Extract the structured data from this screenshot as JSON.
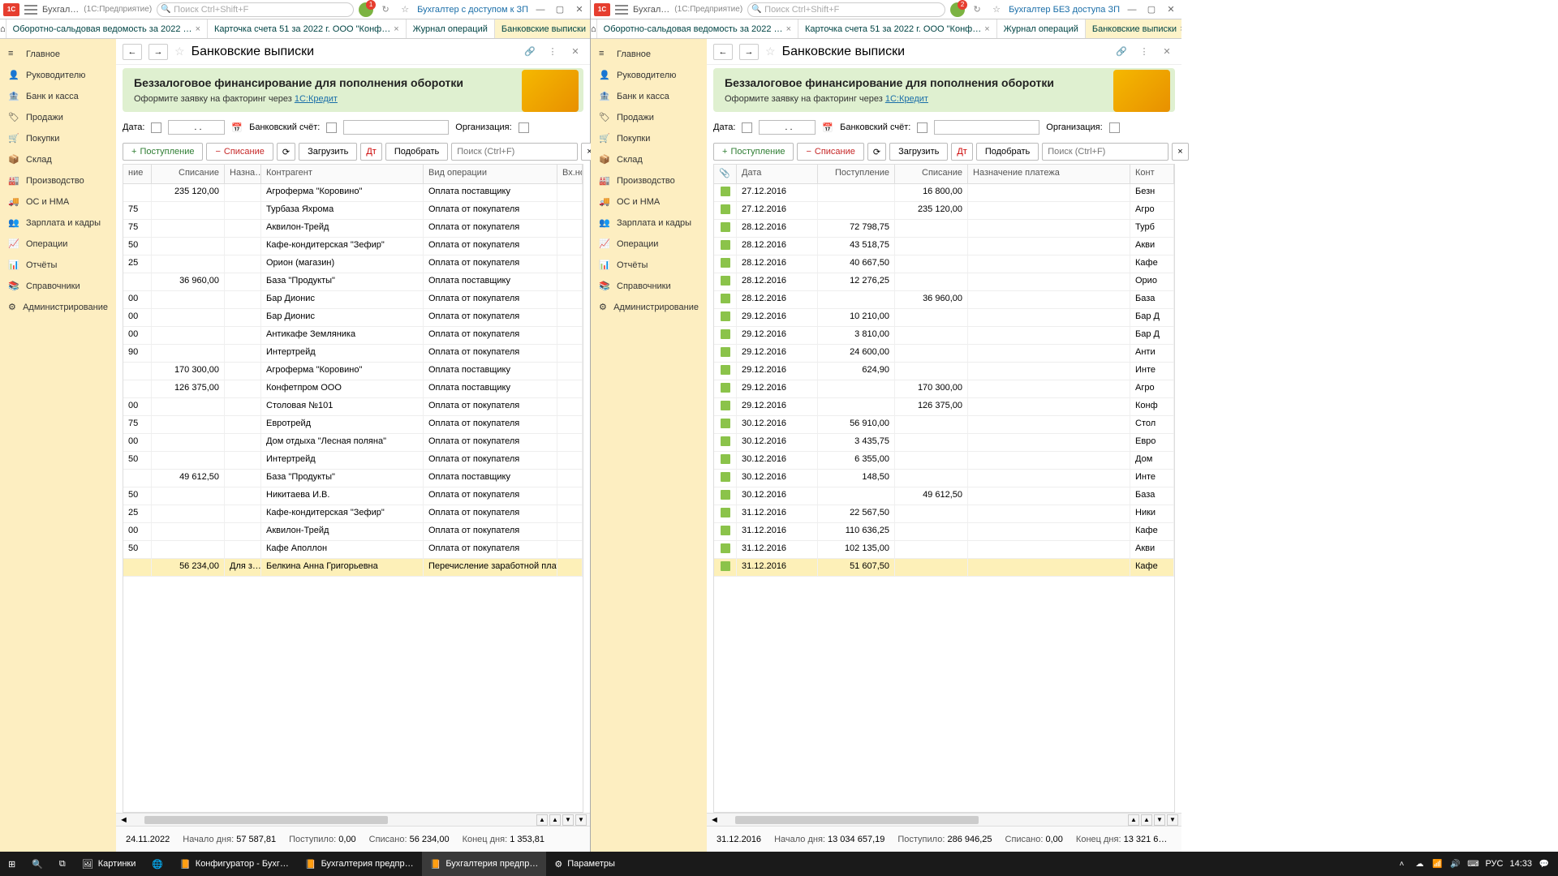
{
  "left": {
    "appTitle": "Бухгал…",
    "appSubtitle": "(1С:Предприятие)",
    "searchPlaceholder": "Поиск Ctrl+Shift+F",
    "badgeNum": "1",
    "userLabel": "Бухгалтер с доступом к ЗП",
    "tabs": [
      "Оборотно-сальдовая ведомость за 2022 …",
      "Карточка счета 51 за 2022 г. ООО \"Конф…",
      "Журнал операций",
      "Банковские выписки"
    ],
    "activeTab": 3,
    "pageTitle": "Банковские выписки",
    "banner": {
      "title": "Беззалоговое финансирование для пополнения оборотки",
      "sub": "Оформите заявку на факторинг через ",
      "link": "1С:Кредит"
    },
    "filters": {
      "date": "Дата:",
      "bank": "Банковский счёт:",
      "org": "Организация:"
    },
    "toolbar": {
      "in": "Поступление",
      "out": "Списание",
      "load": "Загрузить",
      "pick": "Подобрать",
      "search": "Поиск (Ctrl+F)"
    },
    "cols": [
      "ние",
      "Списание",
      "Назна…",
      "Контрагент",
      "Вид операции",
      "Вх.ном"
    ],
    "rows": [
      {
        "c0": "",
        "c1": "235 120,00",
        "c3": "Агроферма \"Коровино\"",
        "c4": "Оплата поставщику"
      },
      {
        "c0": "75",
        "c3": "Турбаза Яхрома",
        "c4": "Оплата от покупателя"
      },
      {
        "c0": "75",
        "c3": "Аквилон-Трейд",
        "c4": "Оплата от покупателя"
      },
      {
        "c0": "50",
        "c3": "Кафе-кондитерская \"Зефир\"",
        "c4": "Оплата от покупателя"
      },
      {
        "c0": "25",
        "c3": "Орион (магазин)",
        "c4": "Оплата от покупателя"
      },
      {
        "c0": "",
        "c1": "36 960,00",
        "c3": "База \"Продукты\"",
        "c4": "Оплата поставщику"
      },
      {
        "c0": "00",
        "c3": "Бар Дионис",
        "c4": "Оплата от покупателя"
      },
      {
        "c0": "00",
        "c3": "Бар Дионис",
        "c4": "Оплата от покупателя"
      },
      {
        "c0": "00",
        "c3": "Антикафе Земляника",
        "c4": "Оплата от покупателя"
      },
      {
        "c0": "90",
        "c3": "Интертрейд",
        "c4": "Оплата от покупателя"
      },
      {
        "c0": "",
        "c1": "170 300,00",
        "c3": "Агроферма \"Коровино\"",
        "c4": "Оплата поставщику"
      },
      {
        "c0": "",
        "c1": "126 375,00",
        "c3": "Конфетпром ООО",
        "c4": "Оплата поставщику"
      },
      {
        "c0": "00",
        "c3": "Столовая №101",
        "c4": "Оплата от покупателя"
      },
      {
        "c0": "75",
        "c3": "Евротрейд",
        "c4": "Оплата от покупателя"
      },
      {
        "c0": "00",
        "c3": "Дом отдыха \"Лесная поляна\"",
        "c4": "Оплата от покупателя"
      },
      {
        "c0": "50",
        "c3": "Интертрейд",
        "c4": "Оплата от покупателя"
      },
      {
        "c0": "",
        "c1": "49 612,50",
        "c3": "База \"Продукты\"",
        "c4": "Оплата поставщику"
      },
      {
        "c0": "50",
        "c3": "Никитаева И.В.",
        "c4": "Оплата от покупателя"
      },
      {
        "c0": "25",
        "c3": "Кафе-кондитерская \"Зефир\"",
        "c4": "Оплата от покупателя"
      },
      {
        "c0": "00",
        "c3": "Аквилон-Трейд",
        "c4": "Оплата от покупателя"
      },
      {
        "c0": "50",
        "c3": "Кафе Аполлон",
        "c4": "Оплата от покупателя"
      },
      {
        "c0": "",
        "c1": "56 234,00",
        "c2": "Для з…",
        "c3": "Белкина Анна Григорьевна",
        "c4": "Перечисление заработной платы р…",
        "sel": true
      }
    ],
    "status": {
      "date": "24.11.2022",
      "beginLbl": "Начало дня:",
      "begin": "57 587,81",
      "inLbl": "Поступило:",
      "in": "0,00",
      "outLbl": "Списано:",
      "out": "56 234,00",
      "endLbl": "Конец дня:",
      "end": "1 353,81"
    }
  },
  "right": {
    "appTitle": "Бухгал…",
    "appSubtitle": "(1С:Предприятие)",
    "searchPlaceholder": "Поиск Ctrl+Shift+F",
    "badgeNum": "2",
    "userLabel": "Бухгалтер БЕЗ доступа ЗП",
    "tabs": [
      "Оборотно-сальдовая ведомость за 2022 …",
      "Карточка счета 51 за 2022 г. ООО \"Конф…",
      "Журнал операций",
      "Банковские выписки"
    ],
    "activeTab": 3,
    "pageTitle": "Банковские выписки",
    "cols": [
      "",
      "Дата",
      "Поступление",
      "Списание",
      "Назначение платежа",
      "Конт"
    ],
    "rows": [
      {
        "d": "27.12.2016",
        "in": "",
        "out": "16 800,00",
        "k": "Безн"
      },
      {
        "d": "27.12.2016",
        "in": "",
        "out": "235 120,00",
        "k": "Агро"
      },
      {
        "d": "28.12.2016",
        "in": "72 798,75",
        "k": "Турб"
      },
      {
        "d": "28.12.2016",
        "in": "43 518,75",
        "k": "Акви"
      },
      {
        "d": "28.12.2016",
        "in": "40 667,50",
        "k": "Кафе"
      },
      {
        "d": "28.12.2016",
        "in": "12 276,25",
        "k": "Орио"
      },
      {
        "d": "28.12.2016",
        "in": "",
        "out": "36 960,00",
        "k": "База"
      },
      {
        "d": "29.12.2016",
        "in": "10 210,00",
        "k": "Бар Д"
      },
      {
        "d": "29.12.2016",
        "in": "3 810,00",
        "k": "Бар Д"
      },
      {
        "d": "29.12.2016",
        "in": "24 600,00",
        "k": "Анти"
      },
      {
        "d": "29.12.2016",
        "in": "624,90",
        "k": "Инте"
      },
      {
        "d": "29.12.2016",
        "in": "",
        "out": "170 300,00",
        "k": "Агро"
      },
      {
        "d": "29.12.2016",
        "in": "",
        "out": "126 375,00",
        "k": "Конф"
      },
      {
        "d": "30.12.2016",
        "in": "56 910,00",
        "k": "Стол"
      },
      {
        "d": "30.12.2016",
        "in": "3 435,75",
        "k": "Евро"
      },
      {
        "d": "30.12.2016",
        "in": "6 355,00",
        "k": "Дом "
      },
      {
        "d": "30.12.2016",
        "in": "148,50",
        "k": "Инте"
      },
      {
        "d": "30.12.2016",
        "in": "",
        "out": "49 612,50",
        "k": "База"
      },
      {
        "d": "31.12.2016",
        "in": "22 567,50",
        "k": "Ники"
      },
      {
        "d": "31.12.2016",
        "in": "110 636,25",
        "k": "Кафе"
      },
      {
        "d": "31.12.2016",
        "in": "102 135,00",
        "k": "Акви"
      },
      {
        "d": "31.12.2016",
        "in": "51 607,50",
        "k": "Кафе",
        "sel": true
      }
    ],
    "status": {
      "date": "31.12.2016",
      "beginLbl": "Начало дня:",
      "begin": "13 034 657,19",
      "inLbl": "Поступило:",
      "in": "286 946,25",
      "outLbl": "Списано:",
      "out": "0,00",
      "endLbl": "Конец дня:",
      "end": "13 321 6…"
    }
  },
  "sidebar": [
    {
      "icon": "≡",
      "label": "Главное"
    },
    {
      "icon": "👤",
      "label": "Руководителю"
    },
    {
      "icon": "🏦",
      "label": "Банк и касса"
    },
    {
      "icon": "🏷",
      "label": "Продажи"
    },
    {
      "icon": "🛒",
      "label": "Покупки"
    },
    {
      "icon": "📦",
      "label": "Склад"
    },
    {
      "icon": "🏭",
      "label": "Производство"
    },
    {
      "icon": "🚚",
      "label": "ОС и НМА"
    },
    {
      "icon": "👥",
      "label": "Зарплата и кадры"
    },
    {
      "icon": "📈",
      "label": "Операции"
    },
    {
      "icon": "📊",
      "label": "Отчёты"
    },
    {
      "icon": "📚",
      "label": "Справочники"
    },
    {
      "icon": "⚙",
      "label": "Администрирование"
    }
  ],
  "taskbar": {
    "items": [
      {
        "icon": "🖼",
        "label": "Картинки"
      },
      {
        "icon": "🌐",
        "label": ""
      },
      {
        "icon": "📙",
        "label": "Конфигуратор - Бухг…"
      },
      {
        "icon": "📙",
        "label": "Бухгалтерия предпр…"
      },
      {
        "icon": "📙",
        "label": "Бухгалтерия предпр…",
        "active": true
      },
      {
        "icon": "⚙",
        "label": "Параметры"
      }
    ],
    "lang": "РУС",
    "time": "14:33"
  }
}
